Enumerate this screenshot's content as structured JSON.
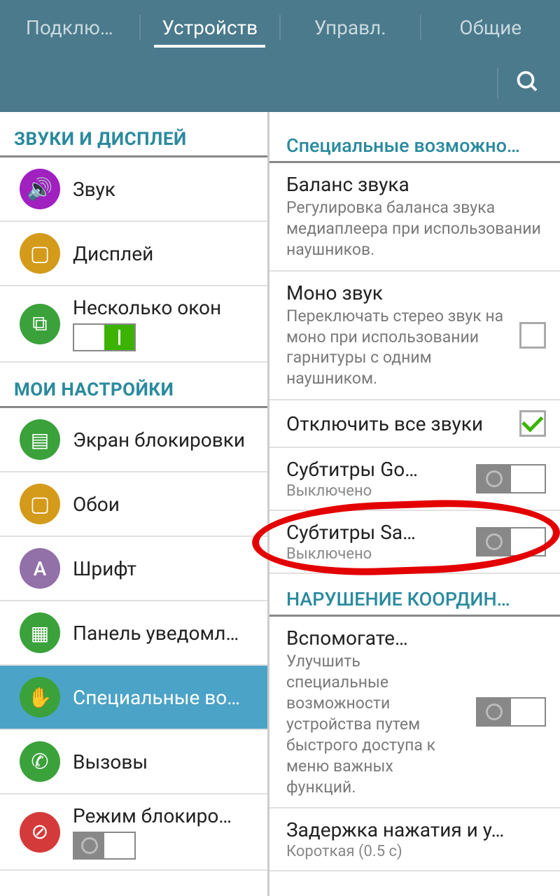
{
  "tabs": [
    "Подклю…",
    "Устройств",
    "Управл.",
    "Общие"
  ],
  "active_tab": 1,
  "left": {
    "sections": [
      {
        "title": "ЗВУКИ И ДИСПЛЕЙ",
        "items": [
          {
            "label": "Звук",
            "icon": "sound",
            "color": "#a020c0"
          },
          {
            "label": "Дисплей",
            "icon": "display",
            "color": "#d49a1a"
          },
          {
            "label": "Несколько окон",
            "icon": "multi",
            "color": "#3ba23b",
            "toggle": "on"
          }
        ]
      },
      {
        "title": "МОИ НАСТРОЙКИ",
        "items": [
          {
            "label": "Экран блокировки",
            "icon": "lock",
            "color": "#3ba23b"
          },
          {
            "label": "Обои",
            "icon": "wall",
            "color": "#d49a1a"
          },
          {
            "label": "Шрифт",
            "icon": "font",
            "color": "#9270a8"
          },
          {
            "label": "Панель уведомл…",
            "icon": "notif",
            "color": "#3ba23b"
          },
          {
            "label": "Специальные во…",
            "icon": "access",
            "color": "#3ba23b",
            "selected": true
          },
          {
            "label": "Вызовы",
            "icon": "call",
            "color": "#3ba23b"
          },
          {
            "label": "Режим блокиро…",
            "icon": "block",
            "color": "#d43a3a",
            "toggle": "off"
          }
        ]
      }
    ]
  },
  "right": {
    "heading": "Специальные возможно…",
    "items": [
      {
        "title": "Баланс звука",
        "desc": "Регулировка баланса звука медиаплеера при использовании наушников."
      },
      {
        "title": "Моно звук",
        "desc": "Переключать стерео звук на моно при использовании гарнитуры с одним наушником.",
        "control": "checkbox",
        "checked": false
      },
      {
        "title": "Отключить все звуки",
        "control": "checkbox",
        "checked": true
      },
      {
        "title": "Субтитры Go…",
        "sub": "Выключено",
        "control": "switch",
        "on": false
      },
      {
        "title": "Субтитры Sa…",
        "sub": "Выключено",
        "control": "switch",
        "on": false
      }
    ],
    "section2_title": "НАРУШЕНИЕ КООРДИН…",
    "items2": [
      {
        "title": "Вспомогате…",
        "desc": "Улучшить специальные возможности устройства путем быстрого доступа к меню важных функций.",
        "control": "switch",
        "on": false
      },
      {
        "title": "Задержка нажатия и у…",
        "sub": "Короткая (0.5 с)"
      }
    ]
  }
}
